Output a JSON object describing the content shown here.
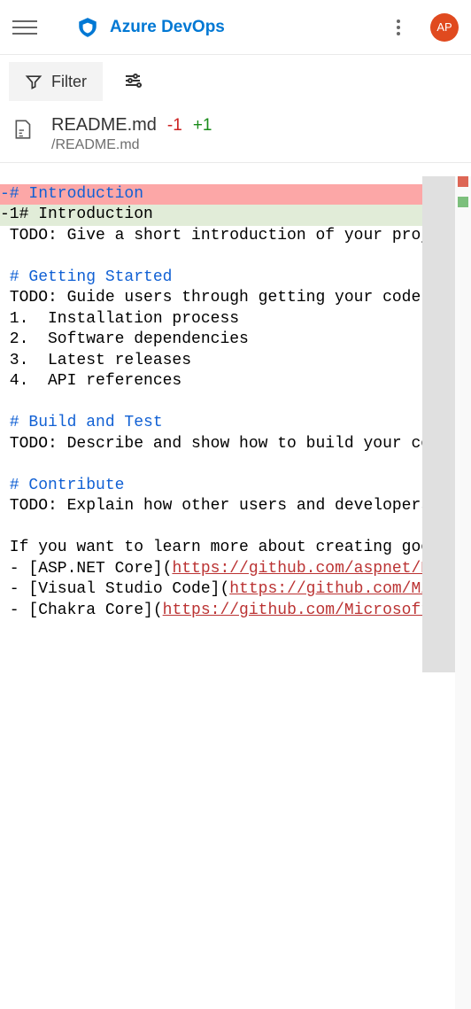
{
  "header": {
    "brand": "Azure DevOps",
    "avatar": "AP"
  },
  "toolbar": {
    "filter": "Filter"
  },
  "file": {
    "name": "README.md",
    "minus": "-1",
    "plus": "+1",
    "path": "/README.md"
  },
  "diff": {
    "del": "-# Introduction",
    "add": "-1# Introduction",
    "l1": " TODO: Give a short introduction of your project.",
    "l2": " ",
    "h2": " # Getting Started",
    "l3": " TODO: Guide users through getting your code up and running.",
    "l4": " 1.  Installation process",
    "l5": " 2.  Software dependencies",
    "l6": " 3.  Latest releases",
    "l7": " 4.  API references",
    "l8": " ",
    "h3": " # Build and Test",
    "l9": " TODO: Describe and show how to build your code and run tests.",
    "l10": " ",
    "h4": " # Contribute",
    "l11": " TODO: Explain how other users and developers can contribute.",
    "l12": " ",
    "l13": " If you want to learn more about creating good readme files:",
    "li1a": " - [ASP.NET Core](",
    "li1b": "https://github.com/aspnet/Home)",
    "li2a": " - [Visual Studio Code](",
    "li2b": "https://github.com/Microsoft/vscode)",
    "li3a": " - [Chakra Core](",
    "li3b": "https://github.com/Microsoft/ChakraCore)"
  }
}
